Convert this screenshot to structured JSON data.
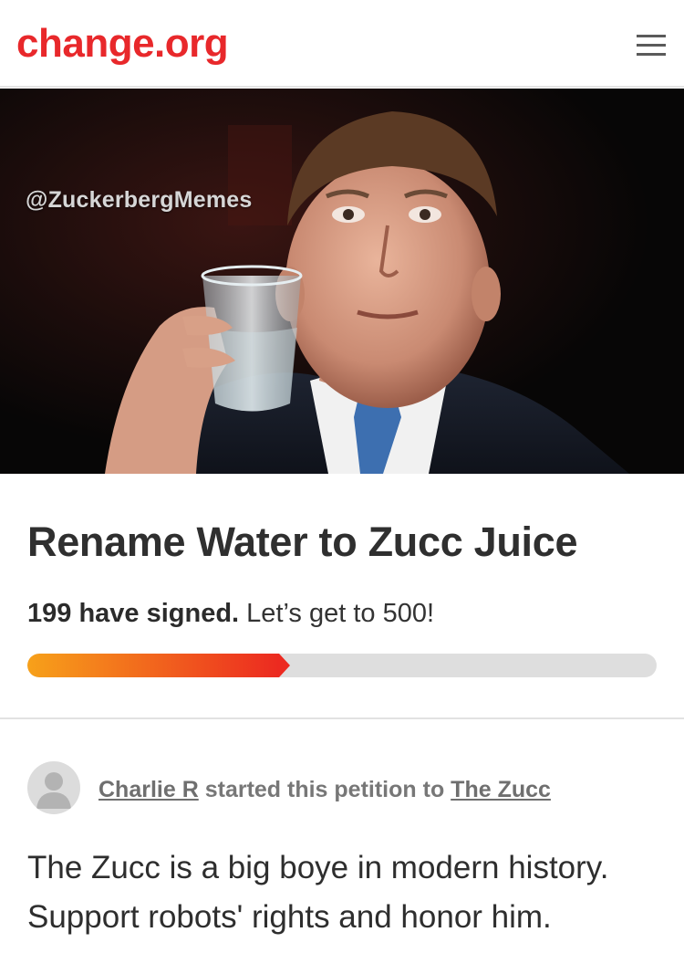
{
  "header": {
    "logo_text": "change.org",
    "menu_icon": "hamburger-menu-icon"
  },
  "colors": {
    "brand": "#e8282b",
    "progress_start": "#f7a11a",
    "progress_end": "#ec2a20",
    "progress_track": "#dedede"
  },
  "hero": {
    "watermark": "@ZuckerbergMemes"
  },
  "petition": {
    "title": "Rename Water to Zucc Juice",
    "signed_count": "199 have signed.",
    "goal_text": " Let’s get to 500!",
    "progress_fraction": 0.4
  },
  "starter": {
    "name": "Charlie R",
    "middle_text": " started this petition to ",
    "target": "The Zucc"
  },
  "description": {
    "line1": "The Zucc is a big boye in modern history.",
    "line2": "Support robots' rights and honor him."
  }
}
